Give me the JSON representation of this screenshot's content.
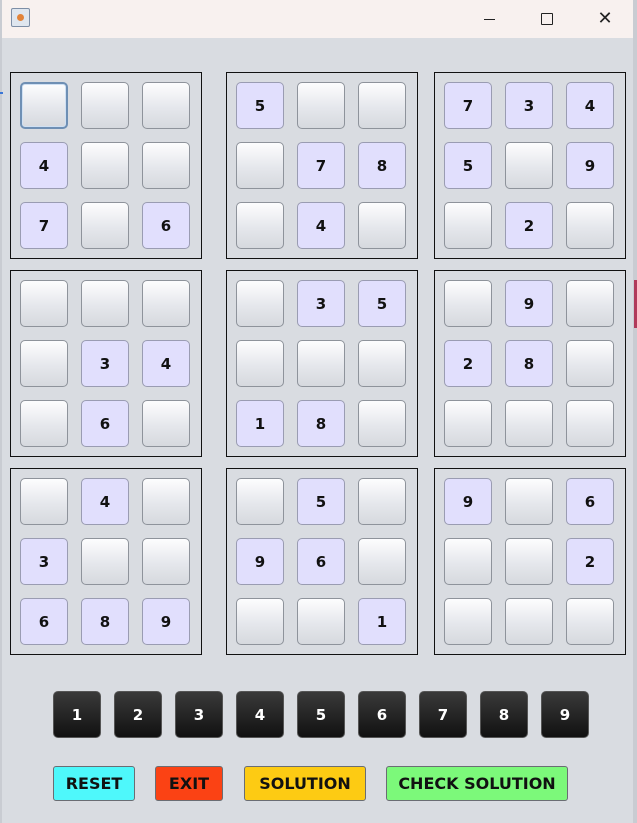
{
  "window": {
    "icon": "java-cup-icon",
    "controls": {
      "minimize": "minimize-icon",
      "maximize": "maximize-icon",
      "close": "✕"
    }
  },
  "grid": {
    "boxes": [
      [
        "",
        "",
        "",
        "4",
        "",
        "",
        "7",
        "",
        "6"
      ],
      [
        "5",
        "",
        "",
        "",
        "7",
        "8",
        "",
        "4",
        ""
      ],
      [
        "7",
        "3",
        "4",
        "5",
        "",
        "9",
        "",
        "2",
        ""
      ],
      [
        "",
        "",
        "",
        "",
        "3",
        "4",
        "",
        "6",
        ""
      ],
      [
        "",
        "3",
        "5",
        "",
        "",
        "",
        "1",
        "8",
        ""
      ],
      [
        "",
        "9",
        "",
        "2",
        "8",
        "",
        "",
        "",
        ""
      ],
      [
        "",
        "4",
        "",
        "3",
        "",
        "",
        "6",
        "8",
        "9"
      ],
      [
        "",
        "5",
        "",
        "9",
        "6",
        "",
        "",
        "",
        "1"
      ],
      [
        "9",
        "",
        "6",
        "",
        "",
        "2",
        "",
        "",
        ""
      ]
    ]
  },
  "number_pad": [
    "1",
    "2",
    "3",
    "4",
    "5",
    "6",
    "7",
    "8",
    "9"
  ],
  "actions": {
    "reset": "RESET",
    "exit": "EXIT",
    "solution": "SOLUTION",
    "check": "CHECK SOLUTION"
  },
  "colors": {
    "given_cell": "#e1dffd",
    "reset": "#4ef8fb",
    "exit": "#fb4214",
    "solution": "#fdcb13",
    "check": "#7cf97a"
  }
}
